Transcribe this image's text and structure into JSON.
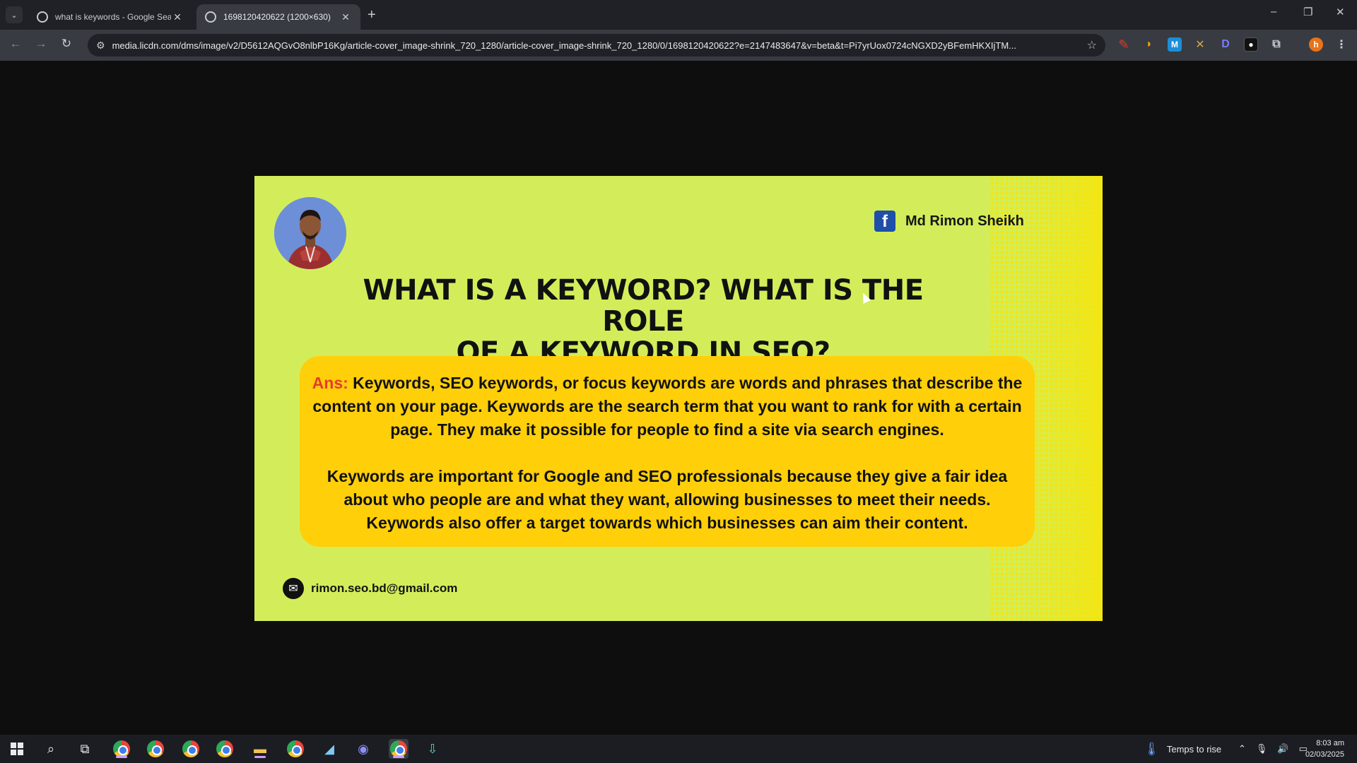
{
  "browser": {
    "tabs": [
      {
        "title": "what is keywords - Google Search",
        "active": false
      },
      {
        "title": "1698120420622 (1200×630)",
        "active": true
      }
    ],
    "new_tab_label": "+",
    "url": "media.licdn.com/dms/image/v2/D5612AQGvO8nlbP16Kg/article-cover_image-shrink_720_1280/article-cover_image-shrink_720_1280/0/1698120420622?e=2147483647&v=beta&t=Pi7yrUox0724cNGXD2yBFemHKXIjTM...",
    "window_controls": {
      "minimize": "–",
      "restore": "❐",
      "close": "✕"
    }
  },
  "card": {
    "author_name": "Md Rimon Sheikh",
    "headline_line1": "WHAT IS A KEYWORD? WHAT IS THE ROLE",
    "headline_line2": "OF A KEYWORD IN SEO?",
    "answer_label": "Ans:",
    "answer_p1": " Keywords, SEO keywords, or focus keywords are words and phrases that describe the content on your page. Keywords are the search term that you want to rank for with a certain page. They make it possible for people to find a site via search engines.",
    "answer_p2": "Keywords are important for Google and SEO professionals because they give a fair idea about who people are and what they want, allowing businesses to meet their needs. Keywords also offer a target towards which businesses can aim their content.",
    "email": "rimon.seo.bd@gmail.com",
    "colors": {
      "background": "#d3ed5a",
      "answer_box": "#ffcf0a",
      "ans_label": "#e83b2c"
    }
  },
  "taskbar": {
    "weather_text": "Temps to rise",
    "time": "8:03 am",
    "date": "02/03/2025"
  }
}
